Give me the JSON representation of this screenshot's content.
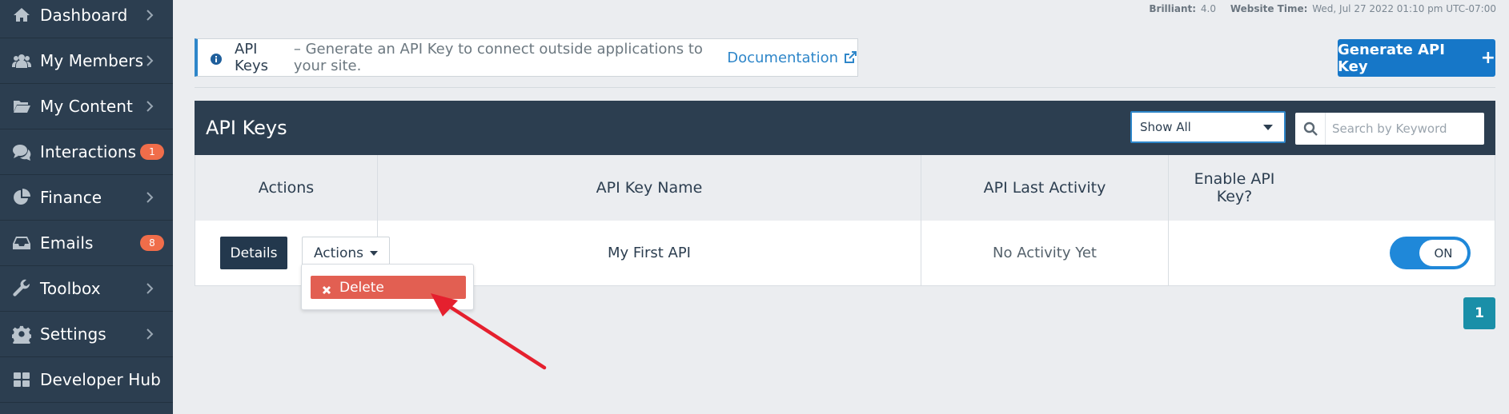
{
  "sidebar": {
    "items": [
      {
        "label": "Dashboard",
        "icon": "home-icon",
        "chevron": true,
        "badge": null
      },
      {
        "label": "My Members",
        "icon": "users-icon",
        "chevron": true,
        "badge": null
      },
      {
        "label": "My Content",
        "icon": "folder-open-icon",
        "chevron": true,
        "badge": null
      },
      {
        "label": "Interactions",
        "icon": "comments-icon",
        "chevron": false,
        "badge": "1"
      },
      {
        "label": "Finance",
        "icon": "pie-chart-icon",
        "chevron": true,
        "badge": null
      },
      {
        "label": "Emails",
        "icon": "inbox-icon",
        "chevron": false,
        "badge": "8"
      },
      {
        "label": "Toolbox",
        "icon": "wrench-icon",
        "chevron": true,
        "badge": null
      },
      {
        "label": "Settings",
        "icon": "gear-icon",
        "chevron": true,
        "badge": null
      },
      {
        "label": "Developer Hub",
        "icon": "grid-icon",
        "chevron": false,
        "badge": null
      }
    ]
  },
  "meta": {
    "version_label": "Brilliant:",
    "version_value": "4.0",
    "time_label": "Website Time:",
    "time_value": "Wed, Jul 27 2022 01:10 pm UTC-07:00"
  },
  "info": {
    "title": "API Keys",
    "description": "– Generate an API Key to connect outside applications to your site.",
    "link_text": "Documentation"
  },
  "generate_button": {
    "label": "Generate API Key",
    "icon": "+"
  },
  "panel": {
    "title": "API Keys",
    "filter": {
      "selected": "Show All"
    },
    "search": {
      "placeholder": "Search by Keyword",
      "value": ""
    }
  },
  "table": {
    "columns": [
      "Actions",
      "API Key Name",
      "API Last Activity",
      "Enable API Key?"
    ],
    "rows": [
      {
        "details_label": "Details",
        "actions_label": "Actions",
        "name": "My First API",
        "last_activity": "No Activity Yet",
        "enabled_label": "ON"
      }
    ]
  },
  "dropdown": {
    "items": [
      {
        "label": "Delete",
        "icon": "times-icon"
      }
    ]
  },
  "pagination": {
    "current": "1"
  },
  "colors": {
    "sidebar": "#2c3e50",
    "primary": "#1677c8",
    "danger": "#e25f52",
    "badge": "#f06d4a",
    "annotation_arrow": "#e5202e"
  }
}
